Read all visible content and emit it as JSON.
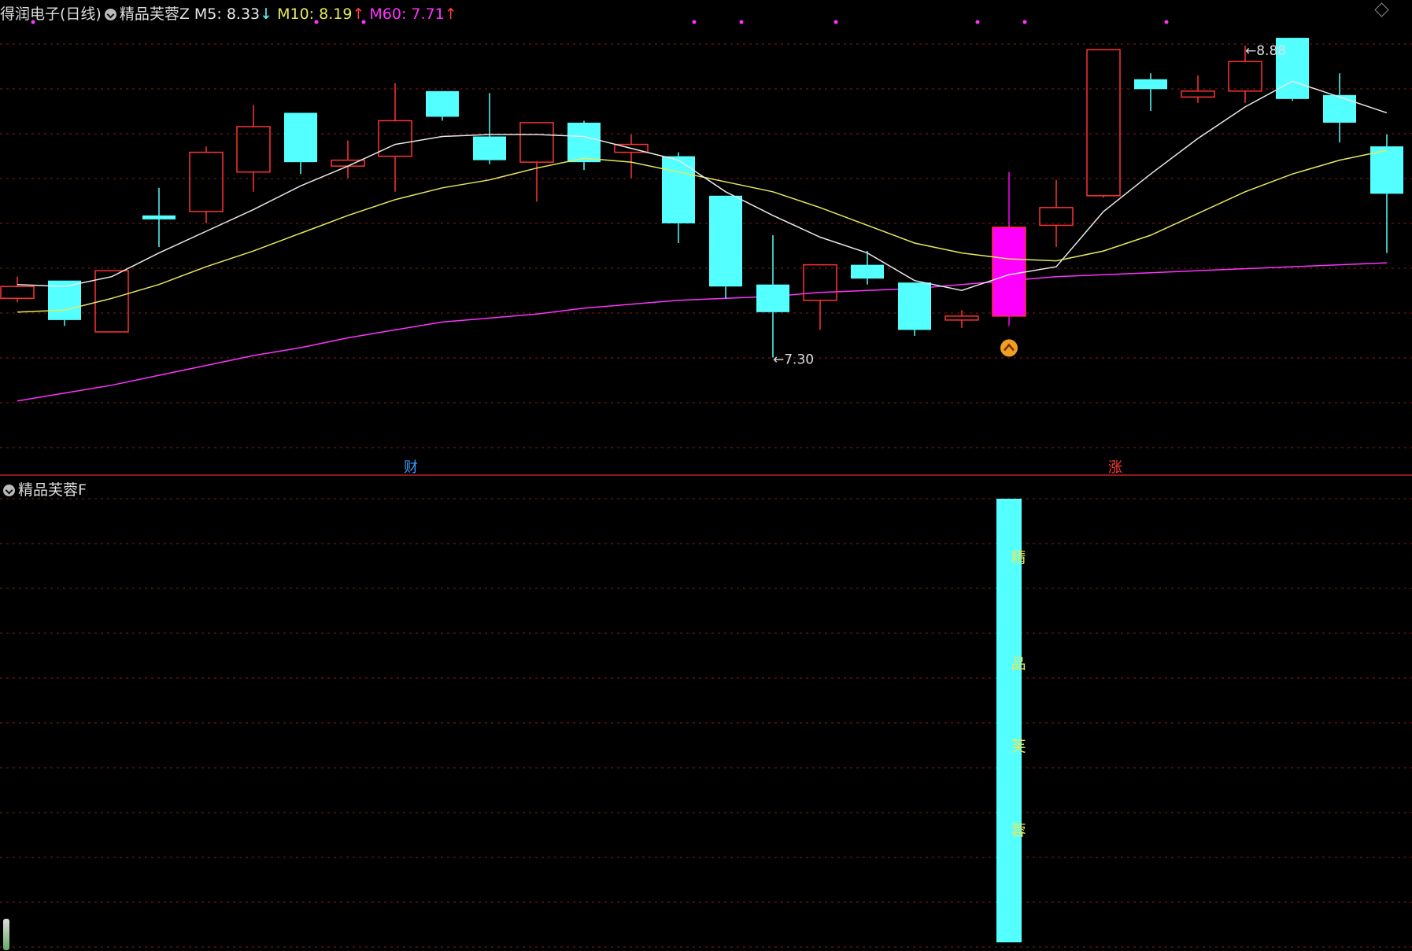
{
  "header": {
    "stock_title": "得润电子(日线)",
    "indicator_name": "精品芙蓉Z",
    "ma5_label": "M5: 8.33",
    "ma5_arrow": "↓",
    "ma10_label": "M10: 8.19",
    "ma10_arrow": "↑",
    "ma60_label": "M60: 7.71",
    "ma60_arrow": "↑"
  },
  "sub_panel": {
    "indicator_name": "精品芙蓉F",
    "bar_text": [
      "精",
      "品",
      "芙",
      "蓉"
    ]
  },
  "colors": {
    "up": "#ff3232",
    "down": "#54ffff",
    "ma5": "#e8e8e8",
    "ma10": "#e8e85a",
    "ma60": "#ff33ff",
    "signal": "#ff00ff",
    "grid": "#8b1a1a"
  },
  "chart_data": {
    "type": "candlestick",
    "ylim": [
      6.8,
      9.0
    ],
    "candles": [
      {
        "o": 7.6,
        "c": 7.66,
        "h": 7.71,
        "l": 7.58
      },
      {
        "o": 7.69,
        "c": 7.49,
        "h": 7.69,
        "l": 7.46
      },
      {
        "o": 7.43,
        "c": 7.74,
        "h": 7.74,
        "l": 7.43
      },
      {
        "o": 8.02,
        "c": 8.0,
        "h": 8.16,
        "l": 7.86
      },
      {
        "o": 8.04,
        "c": 8.34,
        "h": 8.37,
        "l": 7.98
      },
      {
        "o": 8.24,
        "c": 8.47,
        "h": 8.58,
        "l": 8.14
      },
      {
        "o": 8.54,
        "c": 8.29,
        "h": 8.54,
        "l": 8.23
      },
      {
        "o": 8.27,
        "c": 8.3,
        "h": 8.4,
        "l": 8.21
      },
      {
        "o": 8.32,
        "c": 8.5,
        "h": 8.69,
        "l": 8.14
      },
      {
        "o": 8.65,
        "c": 8.52,
        "h": 8.65,
        "l": 8.5
      },
      {
        "o": 8.42,
        "c": 8.3,
        "h": 8.64,
        "l": 8.28
      },
      {
        "o": 8.29,
        "c": 8.49,
        "h": 8.49,
        "l": 8.09
      },
      {
        "o": 8.49,
        "c": 8.29,
        "h": 8.5,
        "l": 8.25
      },
      {
        "o": 8.34,
        "c": 8.38,
        "h": 8.43,
        "l": 8.21
      },
      {
        "o": 8.32,
        "c": 7.98,
        "h": 8.34,
        "l": 7.88
      },
      {
        "o": 8.12,
        "c": 7.66,
        "h": 8.12,
        "l": 7.6
      },
      {
        "o": 7.67,
        "c": 7.53,
        "h": 7.92,
        "l": 7.3
      },
      {
        "o": 7.59,
        "c": 7.77,
        "h": 7.77,
        "l": 7.44
      },
      {
        "o": 7.77,
        "c": 7.7,
        "h": 7.84,
        "l": 7.67
      },
      {
        "o": 7.68,
        "c": 7.44,
        "h": 7.68,
        "l": 7.41
      },
      {
        "o": 7.49,
        "c": 7.51,
        "h": 7.54,
        "l": 7.45
      },
      {
        "o": 7.51,
        "c": 7.96,
        "h": 8.24,
        "l": 7.46
      },
      {
        "o": 7.97,
        "c": 8.06,
        "h": 8.2,
        "l": 7.86
      },
      {
        "o": 8.12,
        "c": 8.86,
        "h": 8.86,
        "l": 8.11
      },
      {
        "o": 8.71,
        "c": 8.66,
        "h": 8.74,
        "l": 8.55
      },
      {
        "o": 8.62,
        "c": 8.65,
        "h": 8.73,
        "l": 8.59
      },
      {
        "o": 8.65,
        "c": 8.8,
        "h": 8.88,
        "l": 8.59
      },
      {
        "o": 8.92,
        "c": 8.61,
        "h": 8.92,
        "l": 8.6
      },
      {
        "o": 8.63,
        "c": 8.49,
        "h": 8.74,
        "l": 8.39
      },
      {
        "o": 8.37,
        "c": 8.13,
        "h": 8.43,
        "l": 7.83
      }
    ],
    "signal_candle_index": 21,
    "ma5": [
      7.67,
      7.66,
      7.71,
      7.83,
      7.94,
      8.05,
      8.17,
      8.27,
      8.38,
      8.42,
      8.43,
      8.43,
      8.42,
      8.36,
      8.3,
      8.14,
      8.02,
      7.91,
      7.83,
      7.69,
      7.64,
      7.72,
      7.76,
      8.04,
      8.23,
      8.41,
      8.57,
      8.7,
      8.62,
      8.54
    ],
    "ma10": [
      7.53,
      7.54,
      7.6,
      7.67,
      7.76,
      7.84,
      7.93,
      8.02,
      8.1,
      8.16,
      8.2,
      8.26,
      8.31,
      8.29,
      8.24,
      8.19,
      8.14,
      8.06,
      7.97,
      7.88,
      7.83,
      7.8,
      7.79,
      7.84,
      7.92,
      8.03,
      8.14,
      8.23,
      8.3,
      8.35
    ],
    "ma60": [
      7.08,
      7.12,
      7.16,
      7.21,
      7.26,
      7.31,
      7.35,
      7.4,
      7.44,
      7.48,
      7.5,
      7.52,
      7.55,
      7.57,
      7.59,
      7.6,
      7.61,
      7.63,
      7.64,
      7.65,
      7.67,
      7.69,
      7.71,
      7.72,
      7.73,
      7.74,
      7.75,
      7.76,
      7.77,
      7.78
    ],
    "annotations": [
      {
        "label": "8.88",
        "candle_index": 26,
        "type": "high"
      },
      {
        "label": "7.30",
        "candle_index": 16,
        "type": "low"
      }
    ],
    "markers": [
      {
        "text": "财",
        "candle_index": 8,
        "color": "#3aa0ff"
      },
      {
        "text": "涨",
        "candle_index": 23,
        "color": "#ff3a3a"
      }
    ],
    "top_dots": [
      0,
      6,
      7,
      14,
      15,
      17,
      20,
      21,
      24
    ]
  }
}
